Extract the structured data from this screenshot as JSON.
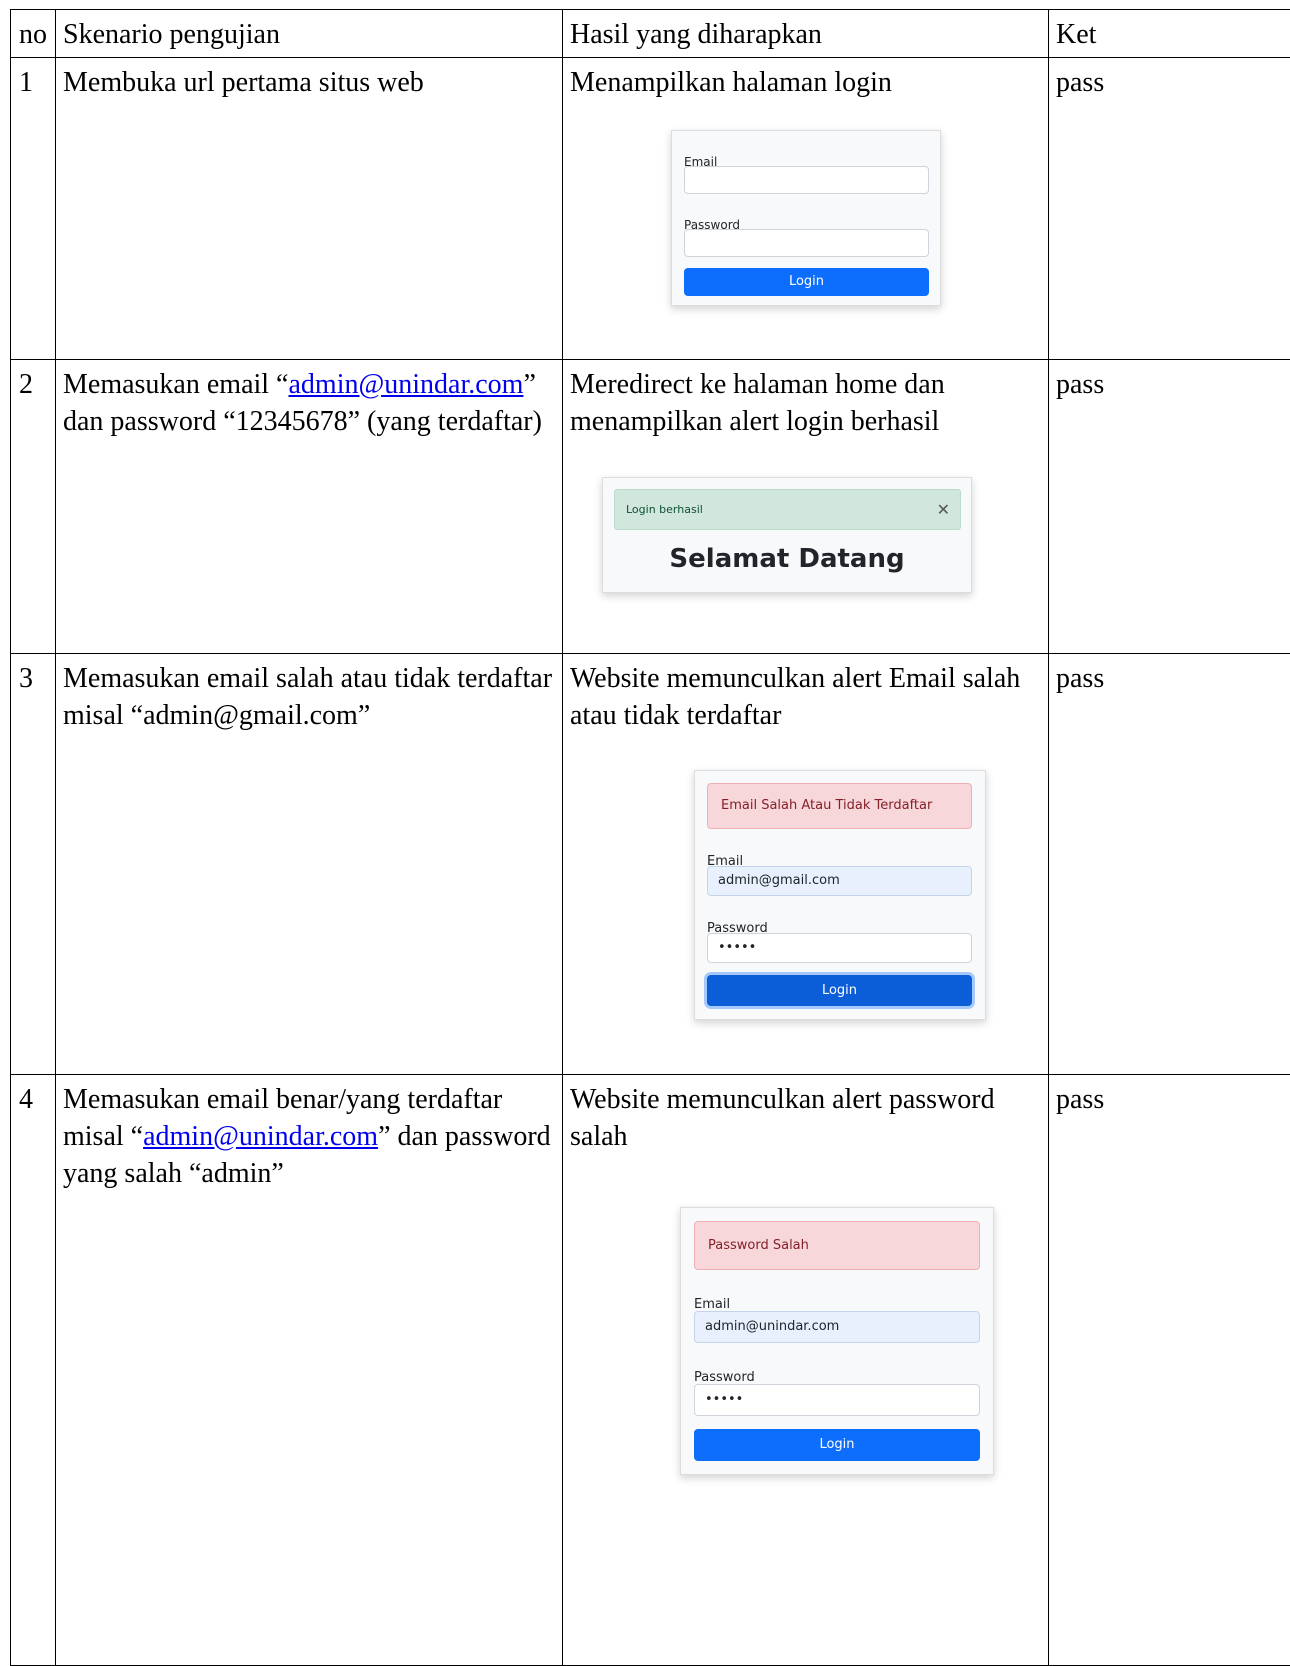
{
  "table": {
    "headers": [
      "no",
      "Skenario pengujian",
      "Hasil yang diharapkan",
      "Ket"
    ],
    "rows": [
      {
        "no": "1",
        "scenario": {
          "text": "Membuka url pertama situs web"
        },
        "expected": "Menampilkan halaman login",
        "ket": "pass"
      },
      {
        "no": "2",
        "scenario": {
          "pre": "Memasukan email “",
          "link": "admin@unindar.com",
          "post": "” dan password “12345678” (yang terdaftar)"
        },
        "expected": "Meredirect ke halaman home dan menampilkan alert login berhasil",
        "ket": "pass"
      },
      {
        "no": "3",
        "scenario": {
          "text": "Memasukan email salah atau tidak terdaftar misal “admin@gmail.com”"
        },
        "expected": "Website memunculkan alert Email salah atau tidak terdaftar",
        "ket": "pass"
      },
      {
        "no": "4",
        "scenario": {
          "pre": "Memasukan email benar/yang terdaftar misal “",
          "link": "admin@unindar.com",
          "post": "” dan password yang salah “admin”"
        },
        "expected": "Website memunculkan alert password salah",
        "ket": "pass"
      }
    ]
  },
  "shots": {
    "login": {
      "email_label": "Email",
      "password_label": "Password",
      "button": "Login"
    },
    "home": {
      "alert": "Login berhasil",
      "close_glyph": "✕",
      "heading": "Selamat Datang"
    },
    "email_error": {
      "alert": "Email Salah Atau Tidak Terdaftar",
      "email_label": "Email",
      "email_value": "admin@gmail.com",
      "password_label": "Password",
      "password_value": "•••••",
      "button": "Login"
    },
    "password_error": {
      "alert": "Password Salah",
      "email_label": "Email",
      "email_value": "admin@unindar.com",
      "password_label": "Password",
      "password_value": "•••••",
      "button": "Login"
    }
  }
}
